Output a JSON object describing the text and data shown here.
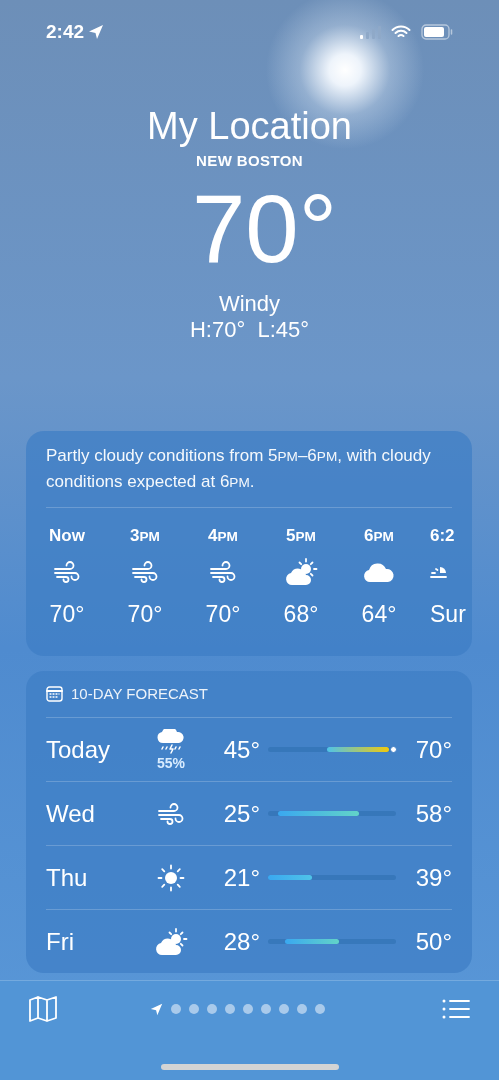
{
  "status_bar": {
    "time": "2:42"
  },
  "header": {
    "title": "My Location",
    "place": "NEW BOSTON",
    "temperature": "70°",
    "condition": "Windy",
    "high_low": "H:70°  L:45°"
  },
  "hourly": {
    "summary": "Partly cloudy conditions from 5PM–6PM, with cloudy conditions expected at 6PM.",
    "hours": [
      {
        "time": "Now",
        "kind": "wind",
        "temp": "70°"
      },
      {
        "time": "3PM",
        "kind": "wind",
        "temp": "70°"
      },
      {
        "time": "4PM",
        "kind": "wind",
        "temp": "70°"
      },
      {
        "time": "5PM",
        "kind": "partly-cloudy",
        "temp": "68°"
      },
      {
        "time": "6PM",
        "kind": "cloudy",
        "temp": "64°"
      },
      {
        "time": "6:2",
        "kind": "sunset",
        "temp": "Sur"
      }
    ]
  },
  "forecast": {
    "title": "10-DAY FORECAST",
    "days": [
      {
        "day": "Today",
        "kind": "thunderstorm",
        "chance": "55%",
        "low": "45°",
        "high": "70°",
        "now_marker": true
      },
      {
        "day": "Wed",
        "kind": "wind",
        "low": "25°",
        "high": "58°",
        "now_marker": false
      },
      {
        "day": "Thu",
        "kind": "sunny",
        "low": "21°",
        "high": "39°",
        "now_marker": false
      },
      {
        "day": "Fri",
        "kind": "partly-cloudy",
        "low": "28°",
        "high": "50°",
        "now_marker": false
      }
    ]
  },
  "pages": [
    {
      "kind": "location",
      "selected": true
    },
    {
      "kind": "dot",
      "selected": false
    },
    {
      "kind": "dot",
      "selected": false
    },
    {
      "kind": "dot",
      "selected": false
    },
    {
      "kind": "dot",
      "selected": false
    },
    {
      "kind": "dot",
      "selected": false
    },
    {
      "kind": "dot",
      "selected": false
    },
    {
      "kind": "dot",
      "selected": false
    },
    {
      "kind": "dot",
      "selected": false
    },
    {
      "kind": "dot",
      "selected": false
    }
  ]
}
